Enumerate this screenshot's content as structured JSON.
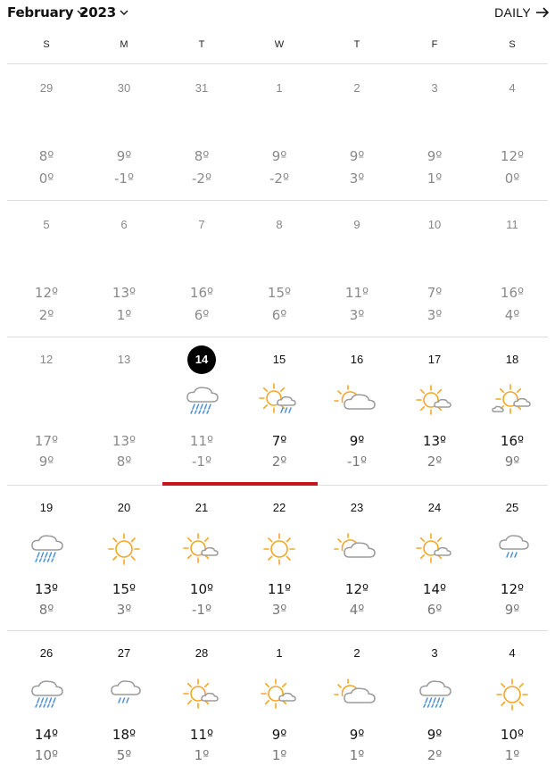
{
  "header": {
    "month": "February",
    "year": "2023",
    "view_toggle": "DAILY"
  },
  "weekdays": [
    "S",
    "M",
    "T",
    "W",
    "T",
    "F",
    "S"
  ],
  "colors": {
    "sun": "#f5a623",
    "cloud": "#9b9b9b",
    "rain": "#4a90d9",
    "today_marker": "#c8141e"
  },
  "weeks": [
    {
      "days": [
        {
          "date": "29",
          "hi": "8º",
          "lo": "0º",
          "state": "past",
          "icon": ""
        },
        {
          "date": "30",
          "hi": "9º",
          "lo": "-1º",
          "state": "past",
          "icon": ""
        },
        {
          "date": "31",
          "hi": "8º",
          "lo": "-2º",
          "state": "past",
          "icon": ""
        },
        {
          "date": "1",
          "hi": "9º",
          "lo": "-2º",
          "state": "past",
          "icon": ""
        },
        {
          "date": "2",
          "hi": "9º",
          "lo": "3º",
          "state": "past",
          "icon": ""
        },
        {
          "date": "3",
          "hi": "9º",
          "lo": "1º",
          "state": "past",
          "icon": ""
        },
        {
          "date": "4",
          "hi": "12º",
          "lo": "0º",
          "state": "past",
          "icon": ""
        }
      ]
    },
    {
      "days": [
        {
          "date": "5",
          "hi": "12º",
          "lo": "2º",
          "state": "past",
          "icon": ""
        },
        {
          "date": "6",
          "hi": "13º",
          "lo": "1º",
          "state": "past",
          "icon": ""
        },
        {
          "date": "7",
          "hi": "16º",
          "lo": "6º",
          "state": "past",
          "icon": ""
        },
        {
          "date": "8",
          "hi": "15º",
          "lo": "6º",
          "state": "past",
          "icon": ""
        },
        {
          "date": "9",
          "hi": "11º",
          "lo": "3º",
          "state": "past",
          "icon": ""
        },
        {
          "date": "10",
          "hi": "7º",
          "lo": "3º",
          "state": "past",
          "icon": ""
        },
        {
          "date": "11",
          "hi": "16º",
          "lo": "4º",
          "state": "past",
          "icon": ""
        }
      ]
    },
    {
      "days": [
        {
          "date": "12",
          "hi": "17º",
          "lo": "9º",
          "state": "past",
          "icon": ""
        },
        {
          "date": "13",
          "hi": "13º",
          "lo": "8º",
          "state": "past",
          "icon": ""
        },
        {
          "date": "14",
          "hi": "11º",
          "lo": "-1º",
          "state": "today",
          "icon": "rain-cloud-icon"
        },
        {
          "date": "15",
          "hi": "7º",
          "lo": "2º",
          "state": "fut",
          "icon": "sun-rain-cloud-icon"
        },
        {
          "date": "16",
          "hi": "9º",
          "lo": "-1º",
          "state": "fut",
          "icon": "partly-cloudy-icon"
        },
        {
          "date": "17",
          "hi": "13º",
          "lo": "2º",
          "state": "fut",
          "icon": "mostly-sunny-icon"
        },
        {
          "date": "18",
          "hi": "16º",
          "lo": "9º",
          "state": "fut",
          "icon": "sun-clouds-icon"
        }
      ]
    },
    {
      "days": [
        {
          "date": "19",
          "hi": "13º",
          "lo": "8º",
          "state": "fut",
          "icon": "rain-cloud-icon"
        },
        {
          "date": "20",
          "hi": "15º",
          "lo": "3º",
          "state": "fut",
          "icon": "sun-icon"
        },
        {
          "date": "21",
          "hi": "10º",
          "lo": "-1º",
          "state": "fut",
          "icon": "mostly-sunny-icon"
        },
        {
          "date": "22",
          "hi": "11º",
          "lo": "3º",
          "state": "fut",
          "icon": "sun-icon"
        },
        {
          "date": "23",
          "hi": "12º",
          "lo": "4º",
          "state": "fut",
          "icon": "partly-cloudy-icon"
        },
        {
          "date": "24",
          "hi": "14º",
          "lo": "6º",
          "state": "fut",
          "icon": "mostly-sunny-icon"
        },
        {
          "date": "25",
          "hi": "12º",
          "lo": "9º",
          "state": "fut",
          "icon": "light-rain-cloud-icon"
        }
      ]
    },
    {
      "days": [
        {
          "date": "26",
          "hi": "14º",
          "lo": "10º",
          "state": "fut",
          "icon": "rain-cloud-icon"
        },
        {
          "date": "27",
          "hi": "18º",
          "lo": "5º",
          "state": "fut",
          "icon": "light-rain-cloud-icon"
        },
        {
          "date": "28",
          "hi": "11º",
          "lo": "1º",
          "state": "fut",
          "icon": "mostly-sunny-icon"
        },
        {
          "date": "1",
          "hi": "9º",
          "lo": "1º",
          "state": "fut",
          "icon": "mostly-sunny-icon"
        },
        {
          "date": "2",
          "hi": "9º",
          "lo": "1º",
          "state": "fut",
          "icon": "partly-cloudy-icon"
        },
        {
          "date": "3",
          "hi": "9º",
          "lo": "2º",
          "state": "fut",
          "icon": "rain-cloud-icon"
        },
        {
          "date": "4",
          "hi": "10º",
          "lo": "1º",
          "state": "fut",
          "icon": "sun-icon"
        }
      ]
    }
  ]
}
